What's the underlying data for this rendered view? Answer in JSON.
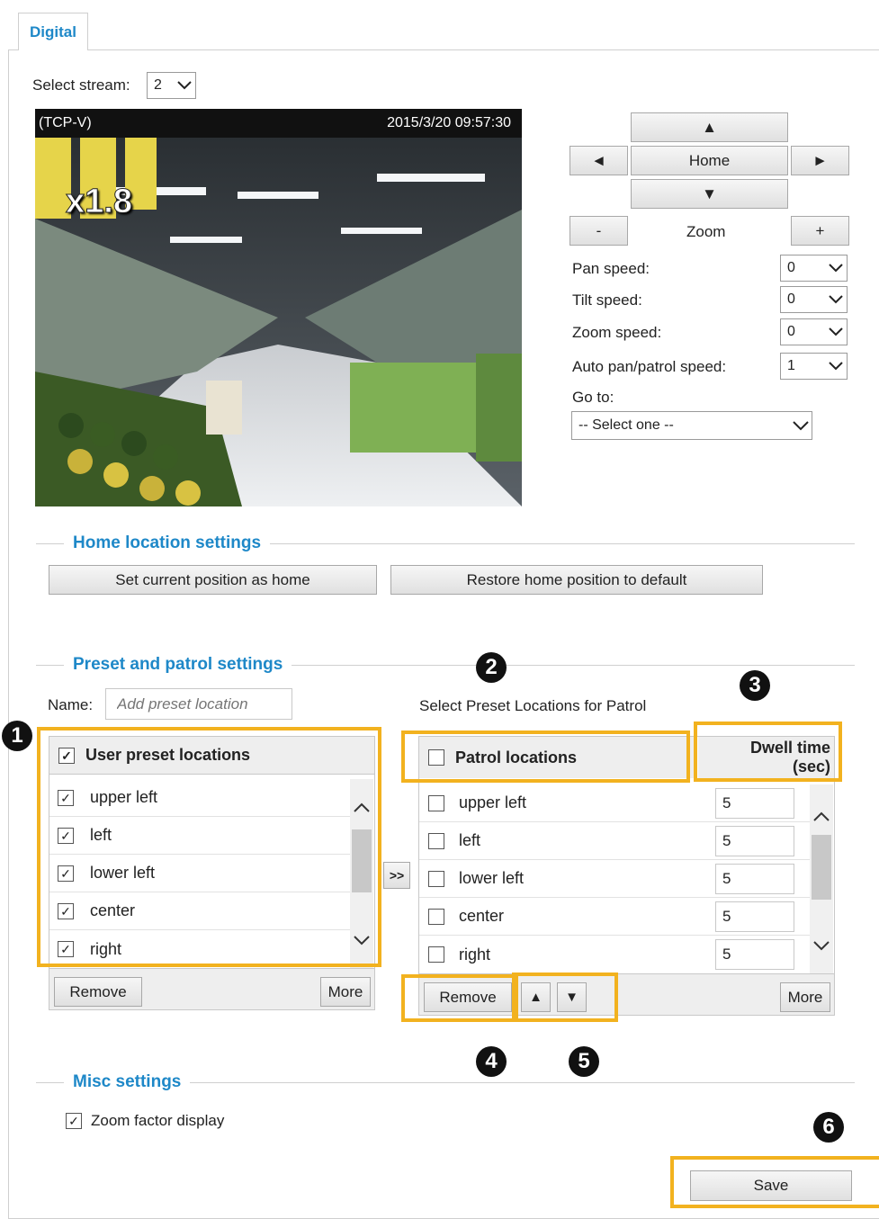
{
  "tab": {
    "label": "Digital"
  },
  "stream": {
    "label": "Select stream:",
    "value": "2"
  },
  "video": {
    "codec_label": "(TCP-V)",
    "timestamp": "2015/3/20 09:57:30",
    "zoom_factor": "x1.8"
  },
  "ptz": {
    "up": "▲",
    "down": "▼",
    "left": "◄",
    "right": "►",
    "home": "Home",
    "zoom_out": "-",
    "zoom_label": "Zoom",
    "zoom_in": "+",
    "pan_speed_label": "Pan speed:",
    "pan_speed": "0",
    "tilt_speed_label": "Tilt speed:",
    "tilt_speed": "0",
    "zoom_speed_label": "Zoom speed:",
    "zoom_speed": "0",
    "auto_speed_label": "Auto pan/patrol speed:",
    "auto_speed": "1",
    "goto_label": "Go to:",
    "goto_value": "-- Select one --"
  },
  "home_section": {
    "title": "Home location settings",
    "set_home": "Set current position as home",
    "restore_home": "Restore home position to default"
  },
  "preset_section": {
    "title": "Preset and patrol settings",
    "name_label": "Name:",
    "name_placeholder": "Add preset location",
    "patrol_caption": "Select Preset Locations for Patrol",
    "user_header": "User preset locations",
    "user_items": [
      "upper left",
      "left",
      "lower left",
      "center",
      "right"
    ],
    "add_button": ">>",
    "remove": "Remove",
    "more": "More",
    "patrol_header": "Patrol locations",
    "dwell_header_1": "Dwell time",
    "dwell_header_2": "(sec)",
    "patrol_items": [
      {
        "name": "upper left",
        "dwell": "5"
      },
      {
        "name": "left",
        "dwell": "5"
      },
      {
        "name": "lower left",
        "dwell": "5"
      },
      {
        "name": "center",
        "dwell": "5"
      },
      {
        "name": "right",
        "dwell": "5"
      }
    ],
    "move_up": "▲",
    "move_down": "▼"
  },
  "misc_section": {
    "title": "Misc settings",
    "zoom_display": "Zoom factor display"
  },
  "save": "Save",
  "callouts": [
    "1",
    "2",
    "3",
    "4",
    "5",
    "6"
  ],
  "colors": {
    "accent": "#1e88c8",
    "highlight": "#f2b21f"
  }
}
